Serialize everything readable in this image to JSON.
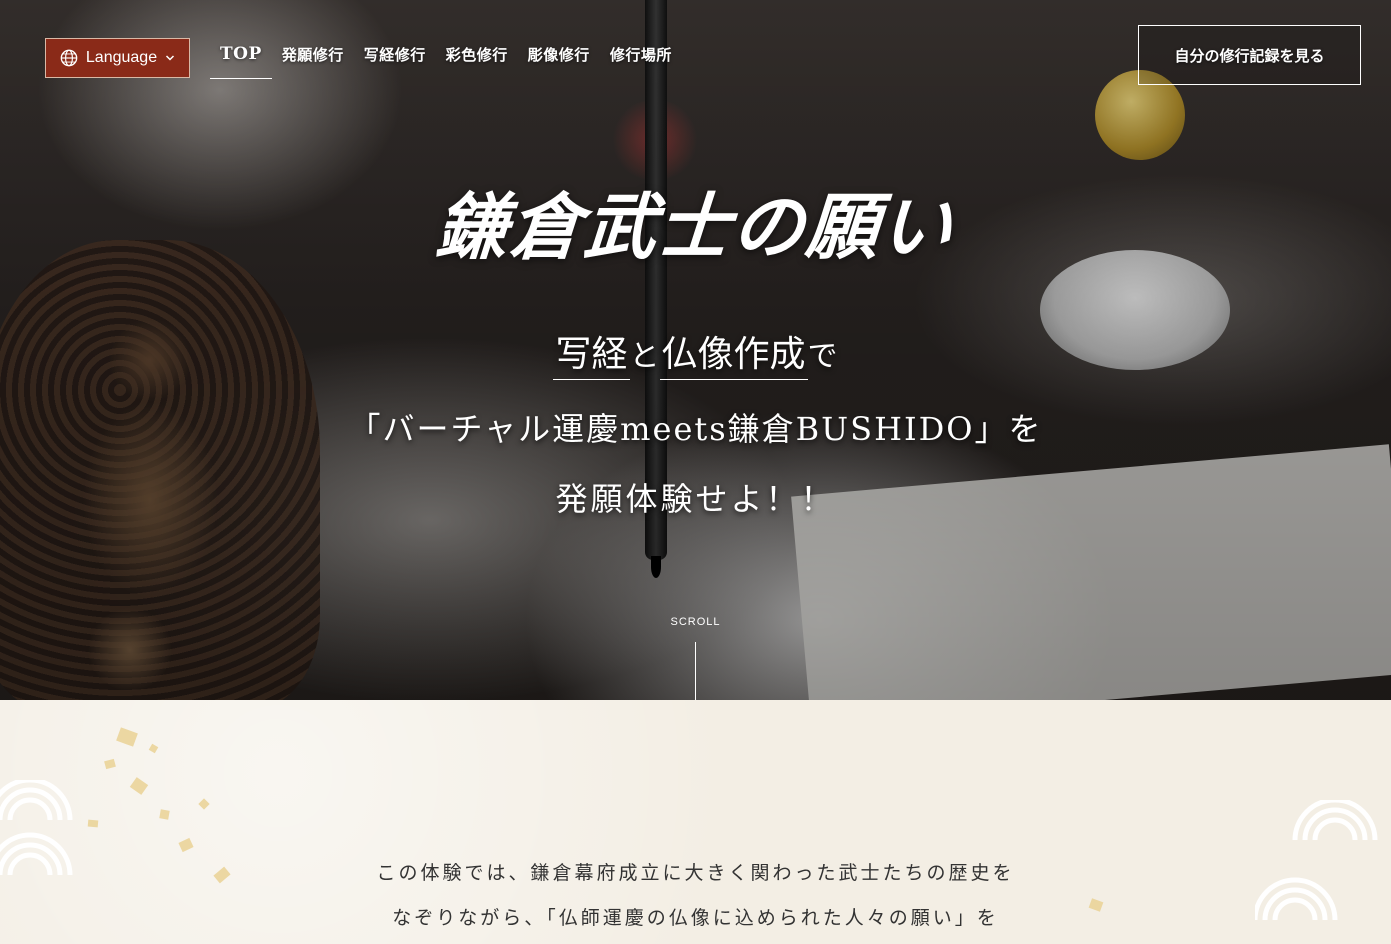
{
  "header": {
    "language_label": "Language",
    "nav": [
      {
        "label": "TOP",
        "active": true
      },
      {
        "label": "発願修行"
      },
      {
        "label": "写経修行"
      },
      {
        "label": "彩色修行"
      },
      {
        "label": "彫像修行"
      },
      {
        "label": "修行場所"
      }
    ],
    "record_button": "自分の修行記録を見る"
  },
  "hero": {
    "logo": "鎌倉武士の願い",
    "catch": {
      "word1": "写経",
      "particle1": "と",
      "word2": "仏像作成",
      "particle2": "で",
      "line2": "「バーチャル運慶meets鎌倉BUSHIDO」を",
      "line3": "発願体験せよ！！"
    },
    "scroll_label": "SCROLL"
  },
  "intro": {
    "line1": "この体験では、鎌倉幕府成立に大きく関わった武士たちの歴史を",
    "line2": "なぞりながら、「仏師運慶の仏像に込められた人々の願い」を"
  },
  "colors": {
    "accent": "#8a2a18",
    "paper_bg": "#f3eee4",
    "gold_leaf": "#e9cf8f"
  },
  "icons": {
    "language": "globe-icon",
    "dropdown": "chevron-down-icon"
  }
}
